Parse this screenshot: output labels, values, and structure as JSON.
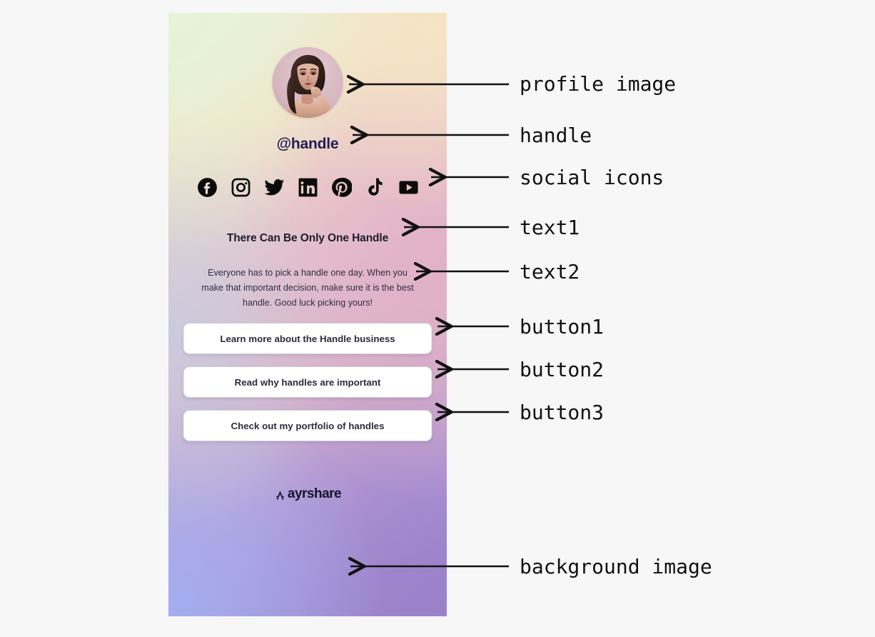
{
  "page": {
    "background_color": "#f7f7f7",
    "card_background_description": "pastel mesh gradient: pale green to cream to pink to periwinkle to purple",
    "card_gradient_colors": [
      "#e5f3d8",
      "#f5e4c4",
      "#e1b0c7",
      "#c6cde0",
      "#a3aef0",
      "#9b81c9"
    ]
  },
  "bio": {
    "avatar_alt": "profile image",
    "handle": "@handle",
    "handle_color": "#20204f",
    "social_icons": [
      {
        "name": "facebook-icon",
        "label": "Facebook"
      },
      {
        "name": "instagram-icon",
        "label": "Instagram"
      },
      {
        "name": "twitter-icon",
        "label": "Twitter"
      },
      {
        "name": "linkedin-icon",
        "label": "LinkedIn"
      },
      {
        "name": "pinterest-icon",
        "label": "Pinterest"
      },
      {
        "name": "tiktok-icon",
        "label": "TikTok"
      },
      {
        "name": "youtube-icon",
        "label": "YouTube"
      }
    ],
    "text1": "There Can Be Only One Handle",
    "text2": "Everyone has to pick a handle one day. When you make that important decision, make sure it is the best handle. Good luck picking yours!",
    "buttons": [
      {
        "label": "Learn more about the Handle business"
      },
      {
        "label": "Read why handles are important"
      },
      {
        "label": "Check out my portfolio of handles"
      }
    ],
    "logo": {
      "mark": "caret-logo-mark",
      "text": "ayrshare"
    }
  },
  "annotations": [
    {
      "id": "profile-image",
      "label": "profile image"
    },
    {
      "id": "handle",
      "label": "handle"
    },
    {
      "id": "social-icons",
      "label": "social icons"
    },
    {
      "id": "text1",
      "label": "text1"
    },
    {
      "id": "text2",
      "label": "text2"
    },
    {
      "id": "button1",
      "label": "button1"
    },
    {
      "id": "button2",
      "label": "button2"
    },
    {
      "id": "button3",
      "label": "button3"
    },
    {
      "id": "background-image",
      "label": "background image"
    }
  ]
}
